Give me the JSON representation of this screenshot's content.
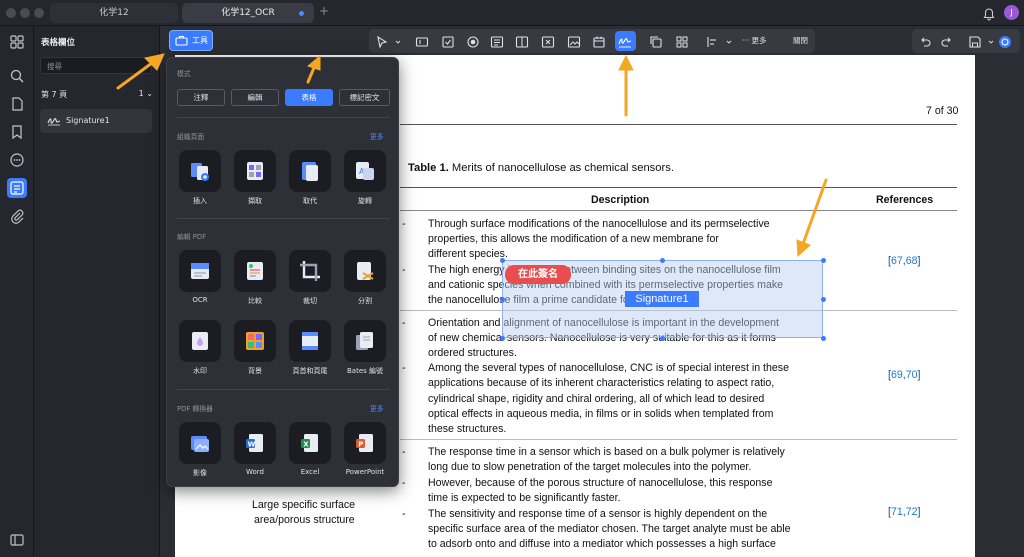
{
  "tabs": [
    {
      "label": "化学12"
    },
    {
      "label": "化学12_OCR"
    }
  ],
  "avatar_letter": "J",
  "side_panel": {
    "title": "表格欄位",
    "search_placeholder": "搜尋",
    "page_label": "第 7 頁",
    "page_count": "1",
    "item": "Signature1"
  },
  "tool_button": "工具",
  "toolbar": {
    "more": "更多",
    "close": "關閉"
  },
  "popup": {
    "mode_label": "模式",
    "modes": [
      "注釋",
      "編輯",
      "表格",
      "標記密文"
    ],
    "active_mode": "表格",
    "organize_label": "組織頁面",
    "organize_more": "更多",
    "organize": [
      "插入",
      "擷取",
      "取代",
      "旋轉"
    ],
    "edit_label": "編輯 PDF",
    "edit_row1": [
      "OCR",
      "比較",
      "裁切",
      "分割"
    ],
    "edit_row2": [
      "水印",
      "背景",
      "頁首和頁尾",
      "Bates 編號"
    ],
    "convert_label": "PDF 轉換器",
    "convert_more": "更多",
    "convert": [
      "影像",
      "Word",
      "Excel",
      "PowerPoint"
    ]
  },
  "document": {
    "page_indicator": "7 of 30",
    "table_caption_bold": "Table 1.",
    "table_caption": " Merits of nanocellulose as chemical sensors.",
    "col_description": "Description",
    "col_references": "References",
    "row3_label_line1": "Large specific surface",
    "row3_label_line2": "area/porous structure",
    "lines": [
      "Through surface modifications of the nanocellulose and its permselective",
      "properties, this allows the modification of a new membrane for",
      "different species.",
      "The high energy interaction between binding sites on the nanocellulose film",
      "and cationic species when combined with its permselective properties make",
      "the nanocellulose film a prime candidate for ion devices.",
      "Orientation and alignment of nanocellulose is important in the development",
      "of new chemical sensors. Nanocellulose is very suitable for this as it forms",
      "ordered structures.",
      "Among the several types of nanocellulose, CNC is of special interest in these",
      "applications because of its inherent characteristics relating to aspect ratio,",
      "cylindrical shape, rigidity and chiral ordering, all of which lead to desired",
      "optical effects in aqueous media, in films or in solids when templated from",
      "these structures.",
      "The response time in a sensor which is based on a bulk polymer is relatively",
      "long due to slow penetration of the target molecules into the polymer.",
      "However, because of the porous structure of nanocellulose, this response",
      "time is expected to be significantly faster.",
      "The sensitivity and response time of a sensor is highly dependent on the",
      "specific surface area of the mediator chosen. The target analyte must be able",
      "to adsorb onto and diffuse into a mediator which possesses a high surface"
    ],
    "refs": [
      {
        "a": "67",
        "b": "68"
      },
      {
        "a": "69",
        "b": "70"
      },
      {
        "a": "71",
        "b": "72"
      }
    ],
    "dash": "-",
    "comma": ",",
    "lb": "[",
    "rb": "]"
  },
  "signature_field": {
    "sign_here": "在此簽名",
    "name": "Signature1"
  },
  "colors": {
    "accent": "#3b7bff",
    "sign_badge": "#ea4d4d",
    "arrow": "#f5a623"
  }
}
